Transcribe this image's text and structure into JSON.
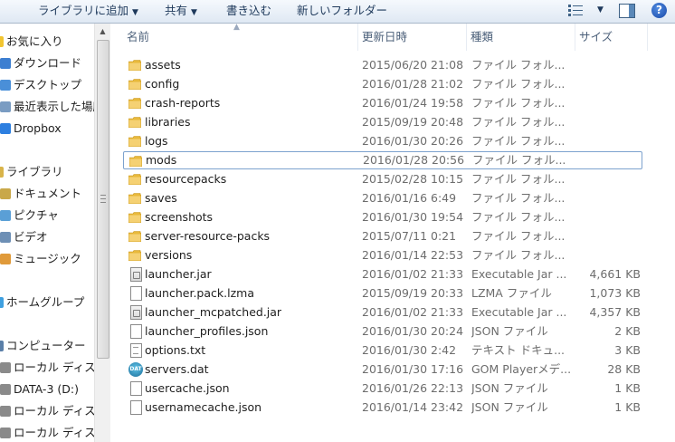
{
  "toolbar": {
    "library_label": "ライブラリに追加",
    "share_label": "共有",
    "burn_label": "書き込む",
    "newfolder_label": "新しいフォルダー",
    "view_icon": "view-options-icon",
    "preview_icon": "preview-pane-icon",
    "help_icon": "help-icon"
  },
  "nav": {
    "items": [
      {
        "label": "お気に入り",
        "icon": "star-icon"
      },
      {
        "label": "ダウンロード",
        "icon": "download-folder-icon"
      },
      {
        "label": "デスクトップ",
        "icon": "desktop-icon"
      },
      {
        "label": "最近表示した場所",
        "icon": "recent-places-icon"
      },
      {
        "label": "Dropbox",
        "icon": "dropbox-icon"
      },
      {
        "label": "ライブラリ",
        "icon": "library-icon"
      },
      {
        "label": "ドキュメント",
        "icon": "documents-icon"
      },
      {
        "label": "ピクチャ",
        "icon": "pictures-icon"
      },
      {
        "label": "ビデオ",
        "icon": "videos-icon"
      },
      {
        "label": "ミュージック",
        "icon": "music-icon"
      },
      {
        "label": "ホームグループ",
        "icon": "homegroup-icon"
      },
      {
        "label": "コンピューター",
        "icon": "computer-icon"
      },
      {
        "label": "ローカル ディスク",
        "icon": "drive-icon"
      },
      {
        "label": "DATA-3 (D:)",
        "icon": "drive-icon"
      },
      {
        "label": "ローカル ディスク",
        "icon": "drive-icon"
      },
      {
        "label": "ローカル ディスク",
        "icon": "drive-icon"
      }
    ]
  },
  "columns": {
    "name": "名前",
    "date": "更新日時",
    "type": "種類",
    "size": "サイズ"
  },
  "files": [
    {
      "name": "assets",
      "date": "2015/06/20 21:08",
      "type": "ファイル フォル...",
      "size": "",
      "icon": "folder-icon"
    },
    {
      "name": "config",
      "date": "2016/01/28 21:02",
      "type": "ファイル フォル...",
      "size": "",
      "icon": "folder-icon"
    },
    {
      "name": "crash-reports",
      "date": "2016/01/24 19:58",
      "type": "ファイル フォル...",
      "size": "",
      "icon": "folder-icon"
    },
    {
      "name": "libraries",
      "date": "2015/09/19 20:48",
      "type": "ファイル フォル...",
      "size": "",
      "icon": "folder-icon"
    },
    {
      "name": "logs",
      "date": "2016/01/30 20:26",
      "type": "ファイル フォル...",
      "size": "",
      "icon": "folder-icon"
    },
    {
      "name": "mods",
      "date": "2016/01/28 20:56",
      "type": "ファイル フォル...",
      "size": "",
      "icon": "folder-icon"
    },
    {
      "name": "resourcepacks",
      "date": "2015/02/28 10:15",
      "type": "ファイル フォル...",
      "size": "",
      "icon": "folder-icon"
    },
    {
      "name": "saves",
      "date": "2016/01/16 6:49",
      "type": "ファイル フォル...",
      "size": "",
      "icon": "folder-icon"
    },
    {
      "name": "screenshots",
      "date": "2016/01/30 19:54",
      "type": "ファイル フォル...",
      "size": "",
      "icon": "folder-icon"
    },
    {
      "name": "server-resource-packs",
      "date": "2015/07/11 0:21",
      "type": "ファイル フォル...",
      "size": "",
      "icon": "folder-icon"
    },
    {
      "name": "versions",
      "date": "2016/01/14 22:53",
      "type": "ファイル フォル...",
      "size": "",
      "icon": "folder-icon"
    },
    {
      "name": "launcher.jar",
      "date": "2016/01/02 21:33",
      "type": "Executable Jar ...",
      "size": "4,661 KB",
      "icon": "jar-file-icon"
    },
    {
      "name": "launcher.pack.lzma",
      "date": "2015/09/19 20:33",
      "type": "LZMA ファイル",
      "size": "1,073 KB",
      "icon": "file-icon"
    },
    {
      "name": "launcher_mcpatched.jar",
      "date": "2016/01/02 21:33",
      "type": "Executable Jar ...",
      "size": "4,357 KB",
      "icon": "jar-file-icon"
    },
    {
      "name": "launcher_profiles.json",
      "date": "2016/01/30 20:24",
      "type": "JSON ファイル",
      "size": "2 KB",
      "icon": "file-icon"
    },
    {
      "name": "options.txt",
      "date": "2016/01/30 2:42",
      "type": "テキスト ドキュ...",
      "size": "3 KB",
      "icon": "text-file-icon"
    },
    {
      "name": "servers.dat",
      "date": "2016/01/30 17:16",
      "type": "GOM Playerメデ...",
      "size": "28 KB",
      "icon": "dat-file-icon"
    },
    {
      "name": "usercache.json",
      "date": "2016/01/26 22:13",
      "type": "JSON ファイル",
      "size": "1 KB",
      "icon": "file-icon"
    },
    {
      "name": "usernamecache.json",
      "date": "2016/01/14 23:42",
      "type": "JSON ファイル",
      "size": "1 KB",
      "icon": "file-icon"
    }
  ],
  "dat_icon_text": "DAT",
  "colors": {
    "folder": "#e8b93c",
    "header_text": "#4c607a",
    "focus_border": "#7da2ce"
  }
}
